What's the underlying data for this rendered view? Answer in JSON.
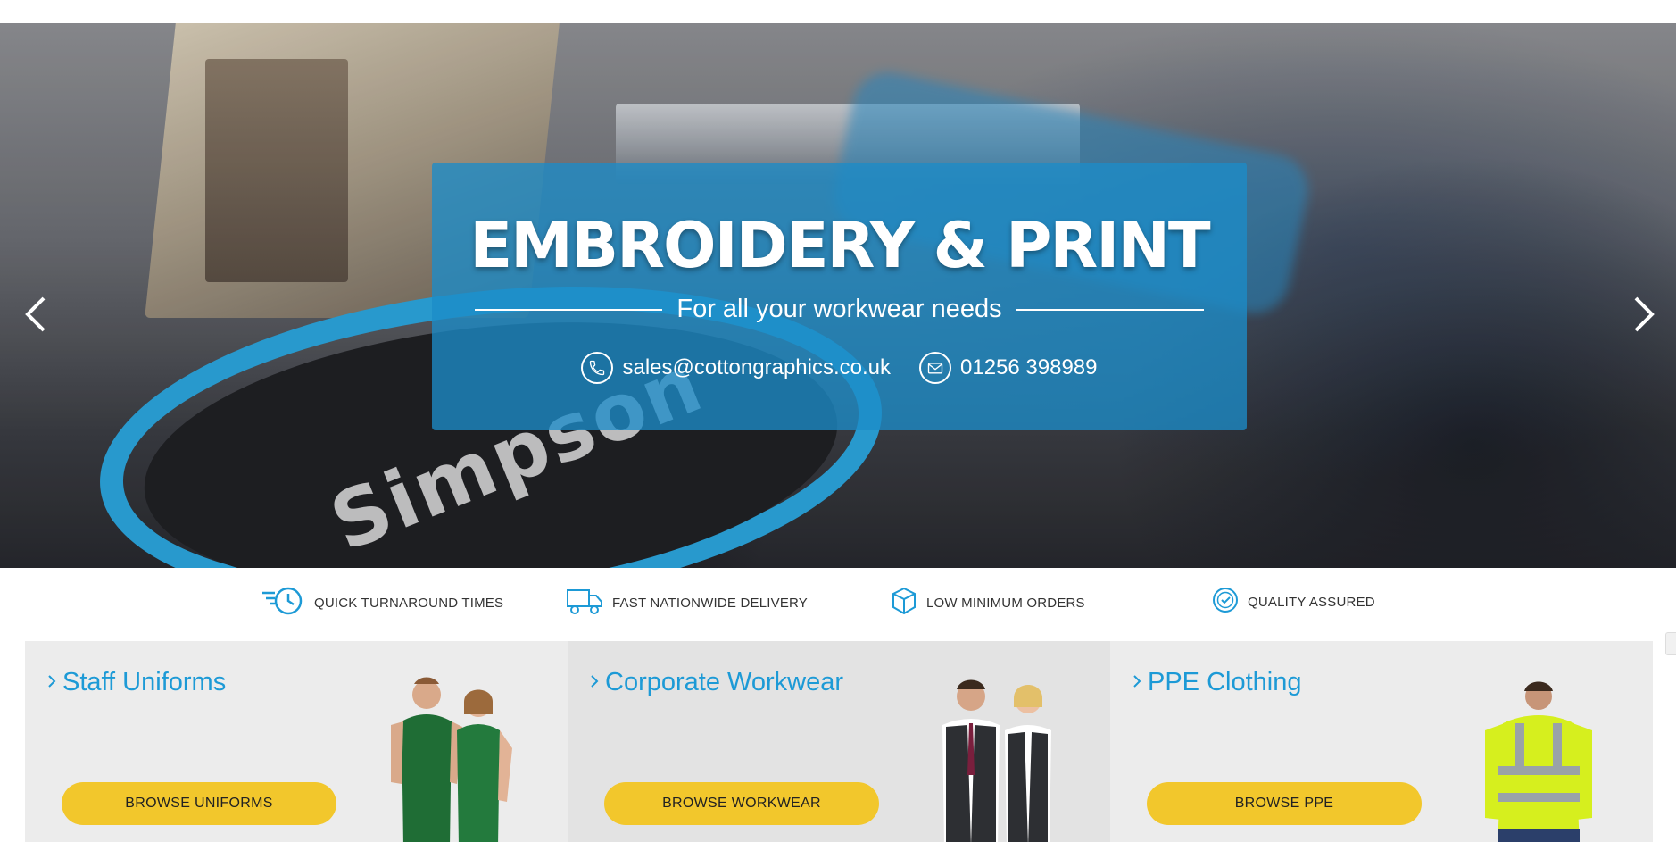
{
  "hero": {
    "title": "EMBROIDERY & PRINT",
    "subtitle": "For all your workwear needs",
    "email": "sales@cottongraphics.co.uk",
    "phone": "01256 398989",
    "email_icon": "phone-icon",
    "phone_icon": "envelope-icon",
    "background_text": "Simpson"
  },
  "features": [
    {
      "label": "QUICK TURNAROUND TIMES",
      "icon": "fast-clock-icon"
    },
    {
      "label": "FAST NATIONWIDE DELIVERY",
      "icon": "delivery-truck-icon"
    },
    {
      "label": "LOW MINIMUM ORDERS",
      "icon": "box-icon"
    },
    {
      "label": "QUALITY ASSURED",
      "icon": "check-badge-icon"
    }
  ],
  "cards": [
    {
      "title": "Staff Uniforms",
      "button": "BROWSE UNIFORMS",
      "bg": "#ececec"
    },
    {
      "title": "Corporate Workwear",
      "button": "BROWSE WORKWEAR",
      "bg": "#e3e3e3"
    },
    {
      "title": "PPE Clothing",
      "button": "BROWSE PPE",
      "bg": "#ececec"
    }
  ],
  "colors": {
    "accent_blue": "#1d9ad6",
    "button_yellow": "#f2c72c",
    "hero_box": "#1c8cc8"
  }
}
